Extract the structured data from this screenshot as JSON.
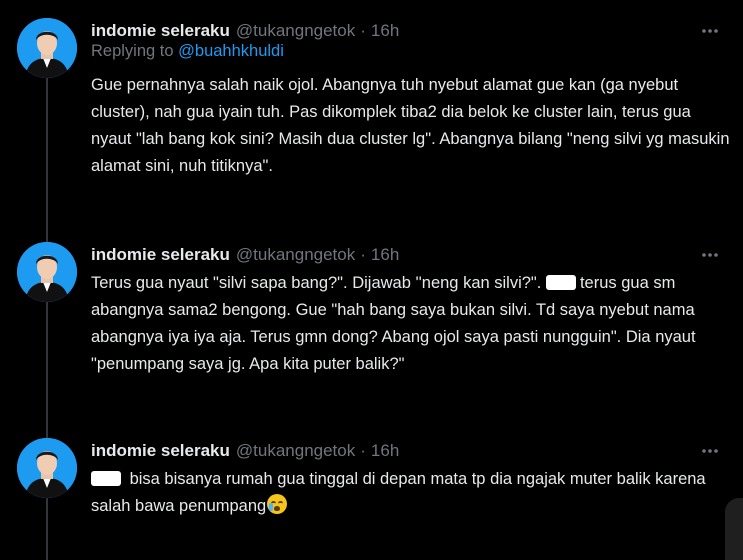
{
  "icons": {
    "avatar": "profile-photo",
    "more": "more-horizontal-icon",
    "redaction": "redacted-word",
    "emoji": "loudly-crying-face"
  },
  "colors": {
    "background": "#000000",
    "text": "#e7e9ea",
    "muted": "#71767b",
    "link": "#1d9bf0"
  },
  "tweets": [
    {
      "name": "indomie seleraku",
      "handle": "@tukangngetok",
      "separator": "·",
      "time": "16h",
      "reply_prefix": "Replying to",
      "reply_to": "@buahhkhuldi",
      "text": "Gue pernahnya salah naik ojol. Abangnya tuh nyebut alamat gue kan (ga nyebut cluster), nah gua iyain tuh. Pas dikomplek tiba2 dia belok ke cluster lain, terus gua nyaut \"lah bang kok sini? Masih dua cluster lg\". Abangnya bilang \"neng silvi yg masukin alamat sini, nuh titiknya\"."
    },
    {
      "name": "indomie seleraku",
      "handle": "@tukangngetok",
      "separator": "·",
      "time": "16h",
      "text_a": "Terus gua nyaut \"silvi sapa bang?\". Dijawab ''neng kan silvi?\". ",
      "text_b": "terus gua sm abangnya sama2 bengong. Gue \"hah bang saya bukan silvi. Td saya nyebut nama abangnya iya iya aja. Terus gmn dong? Abang ojol saya pasti nungguin\". Dia nyaut \"penumpang saya jg. Apa kita puter balik?\""
    },
    {
      "name": "indomie seleraku",
      "handle": "@tukangngetok",
      "separator": "·",
      "time": "16h",
      "text": " bisa bisanya rumah gua tinggal di depan mata tp dia ngajak muter balik karena salah bawa penumpang"
    }
  ]
}
